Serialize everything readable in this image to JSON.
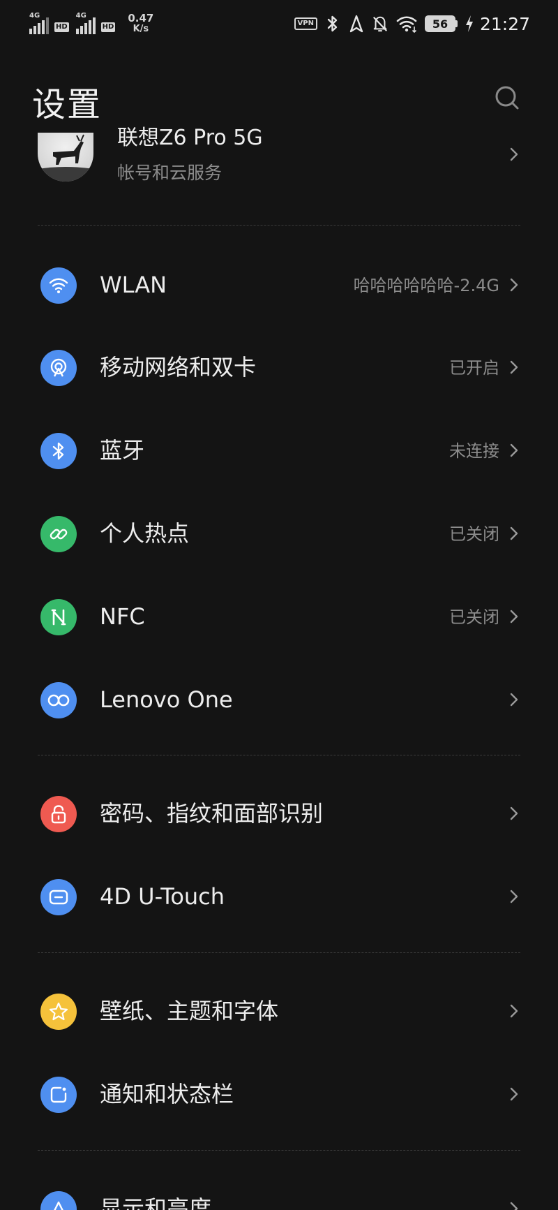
{
  "status_bar": {
    "sim1_network": "4G",
    "sim1_hd": "HD",
    "sim2_network": "4G",
    "sim2_hd": "HD",
    "speed_value": "0.47",
    "speed_unit": "K/s",
    "vpn_label": "VPN",
    "battery": "56",
    "time": "21:27",
    "icons": [
      "bluetooth-icon",
      "location-icon",
      "mute-icon",
      "wifi-icon",
      "charging-icon"
    ]
  },
  "header": {
    "title": "设置",
    "search_icon": "search-icon"
  },
  "account": {
    "name": "联想Z6 Pro 5G",
    "subtitle": "帐号和云服务"
  },
  "sections": [
    [
      {
        "id": "wlan",
        "label": "WLAN",
        "value": "哈哈哈哈哈哈-2.4G",
        "icon": "wifi-icon",
        "color": "#4f8ff0"
      },
      {
        "id": "mobile-network",
        "label": "移动网络和双卡",
        "value": "已开启",
        "icon": "antenna-icon",
        "color": "#4f8ff0"
      },
      {
        "id": "bluetooth",
        "label": "蓝牙",
        "value": "未连接",
        "icon": "bluetooth-icon",
        "color": "#4f8ff0"
      },
      {
        "id": "hotspot",
        "label": "个人热点",
        "value": "已关闭",
        "icon": "link-icon",
        "color": "#36b96a"
      },
      {
        "id": "nfc",
        "label": "NFC",
        "value": "已关闭",
        "icon": "nfc-icon",
        "color": "#36b96a"
      },
      {
        "id": "lenovo-one",
        "label": "Lenovo One",
        "value": "",
        "icon": "infinity-icon",
        "color": "#4f8ff0"
      }
    ],
    [
      {
        "id": "security",
        "label": "密码、指纹和面部识别",
        "value": "",
        "icon": "lock-icon",
        "color": "#ef5a51"
      },
      {
        "id": "u-touch",
        "label": "4D U-Touch",
        "value": "",
        "icon": "touch-icon",
        "color": "#4f8ff0"
      }
    ],
    [
      {
        "id": "theme",
        "label": "壁纸、主题和字体",
        "value": "",
        "icon": "star-icon",
        "color": "#f5c23b"
      },
      {
        "id": "notifications",
        "label": "通知和状态栏",
        "value": "",
        "icon": "notification-icon",
        "color": "#4f8ff0"
      }
    ],
    [
      {
        "id": "display",
        "label": "显示和亮度",
        "value": "",
        "icon": "display-icon",
        "color": "#4f8ff0"
      }
    ]
  ]
}
